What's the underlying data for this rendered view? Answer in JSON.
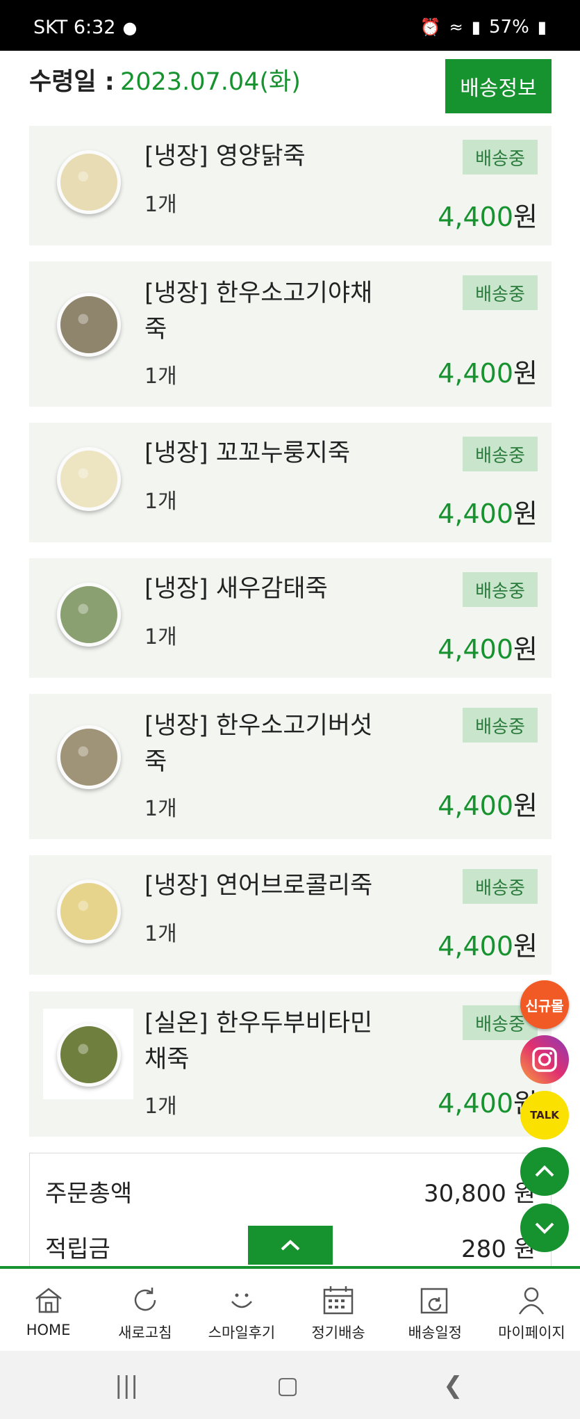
{
  "status_bar": {
    "carrier_time": "SKT 6:32",
    "battery": "57%"
  },
  "header": {
    "date_label": "수령일 :",
    "date_value": "2023.07.04(화)",
    "delivery_info_button": "배송정보"
  },
  "items": [
    {
      "name_line1": "[냉장] 영양닭죽",
      "name_line2": "",
      "qty": "1개",
      "status": "배송중",
      "price": "4,400",
      "currency": "원",
      "thumb_color": "#e8dcb4"
    },
    {
      "name_line1": "[냉장] 한우소고기야채",
      "name_line2": "죽",
      "qty": "1개",
      "status": "배송중",
      "price": "4,400",
      "currency": "원",
      "thumb_color": "#8f846c"
    },
    {
      "name_line1": "[냉장] 꼬꼬누룽지죽",
      "name_line2": "",
      "qty": "1개",
      "status": "배송중",
      "price": "4,400",
      "currency": "원",
      "thumb_color": "#ede4c2"
    },
    {
      "name_line1": "[냉장] 새우감태죽",
      "name_line2": "",
      "qty": "1개",
      "status": "배송중",
      "price": "4,400",
      "currency": "원",
      "thumb_color": "#8aa070"
    },
    {
      "name_line1": "[냉장] 한우소고기버섯",
      "name_line2": "죽",
      "qty": "1개",
      "status": "배송중",
      "price": "4,400",
      "currency": "원",
      "thumb_color": "#a09478"
    },
    {
      "name_line1": "[냉장] 연어브로콜리죽",
      "name_line2": "",
      "qty": "1개",
      "status": "배송중",
      "price": "4,400",
      "currency": "원",
      "thumb_color": "#e6d48c"
    },
    {
      "name_line1": "[실온] 한우두부비타민",
      "name_line2": "채죽",
      "qty": "1개",
      "status": "배송중",
      "price": "4,400",
      "currency": "원",
      "thumb_color": "#6f7f3e"
    }
  ],
  "summary": {
    "total_label": "주문총액",
    "total_value": "30,800 원",
    "points_label": "적립금",
    "points_value": "280 원"
  },
  "floating": {
    "new_badge": "신규몰",
    "talk": "TALK"
  },
  "bottom_nav": [
    {
      "label": "HOME",
      "icon": "home-icon"
    },
    {
      "label": "새로고침",
      "icon": "refresh-icon"
    },
    {
      "label": "스마일후기",
      "icon": "smile-icon"
    },
    {
      "label": "정기배송",
      "icon": "calendar-icon"
    },
    {
      "label": "배송일정",
      "icon": "delivery-schedule-icon"
    },
    {
      "label": "마이페이지",
      "icon": "person-icon"
    }
  ],
  "colors": {
    "brand_green": "#16922f",
    "status_bg": "#c9e6cd",
    "item_bg": "#f3f5f1"
  }
}
